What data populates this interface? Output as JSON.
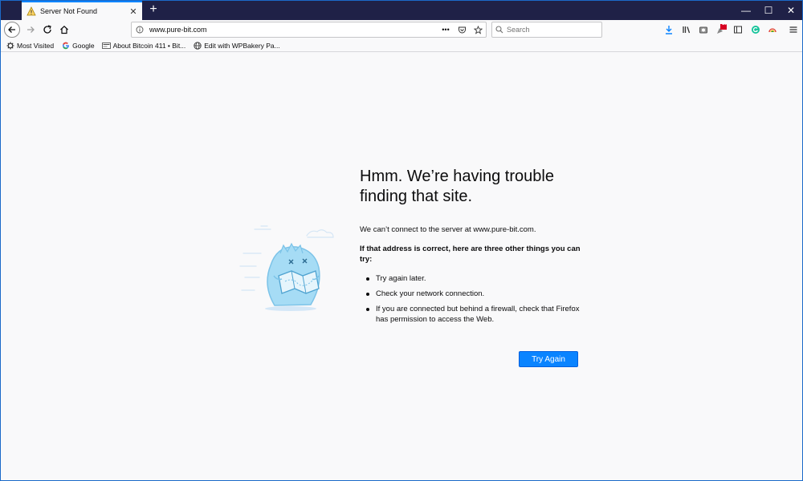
{
  "tab": {
    "title": "Server Not Found",
    "close": "✕"
  },
  "window_controls": {
    "minimize": "—",
    "maximize": "☐",
    "close": "✕",
    "new_tab": "+"
  },
  "urlbar": {
    "url": "www.pure-bit.com",
    "actions": "•••"
  },
  "search": {
    "placeholder": "Search"
  },
  "toolbar": {
    "badge_count": "10"
  },
  "bookmarks": [
    {
      "label": "Most Visited",
      "icon": "gear-icon"
    },
    {
      "label": "Google",
      "icon": "google-icon"
    },
    {
      "label": "About Bitcoin 411 • Bit...",
      "icon": "page-icon"
    },
    {
      "label": "Edit with WPBakery Pa...",
      "icon": "globe-icon"
    }
  ],
  "error": {
    "title_line1": "Hmm. We’re having trouble",
    "title_line2": "finding that site.",
    "message": "We can’t connect to the server at www.pure-bit.com.",
    "suggest_heading": "If that address is correct, here are three other things you can try:",
    "items": [
      "Try again later.",
      "Check your network connection.",
      "If you are connected but behind a firewall, check that Firefox has permission to access the Web."
    ],
    "button": "Try Again"
  },
  "colors": {
    "accent": "#0a84ff",
    "tabstrip": "#1f2147",
    "badge": "#d70022"
  }
}
